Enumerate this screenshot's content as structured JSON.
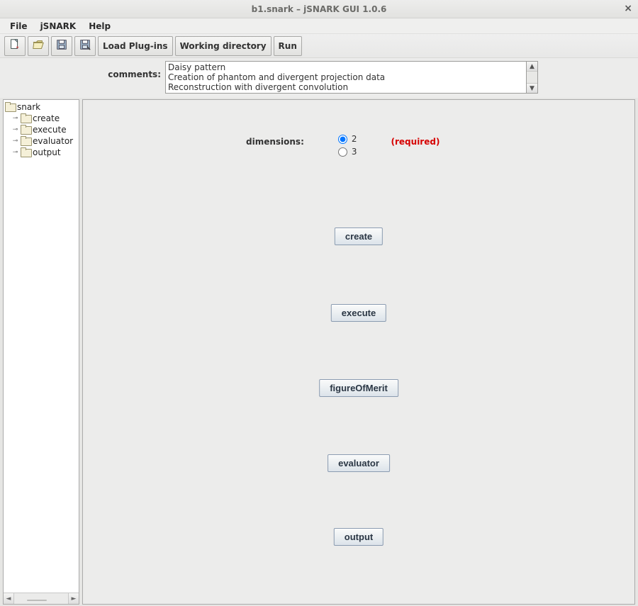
{
  "window": {
    "title": "b1.snark – jSNARK GUI 1.0.6"
  },
  "menu": {
    "file": "File",
    "jsnark": "jSNARK",
    "help": "Help"
  },
  "toolbar": {
    "load_plugins": "Load Plug-ins",
    "working_directory": "Working directory",
    "run": "Run"
  },
  "comments": {
    "label": "comments:",
    "lines": {
      "l0": "Daisy pattern",
      "l1": "Creation of phantom and divergent projection data",
      "l2": "Reconstruction with divergent convolution"
    }
  },
  "tree": {
    "root": "snark",
    "children": {
      "c0": "create",
      "c1": "execute",
      "c2": "evaluator",
      "c3": "output"
    }
  },
  "main": {
    "dimensions_label": "dimensions:",
    "dim_option_2": "2",
    "dim_option_3": "3",
    "dim_selected": "2",
    "required": "(required)",
    "buttons": {
      "create": "create",
      "execute": "execute",
      "figureOfMerit": "figureOfMerit",
      "evaluator": "evaluator",
      "output": "output"
    }
  }
}
